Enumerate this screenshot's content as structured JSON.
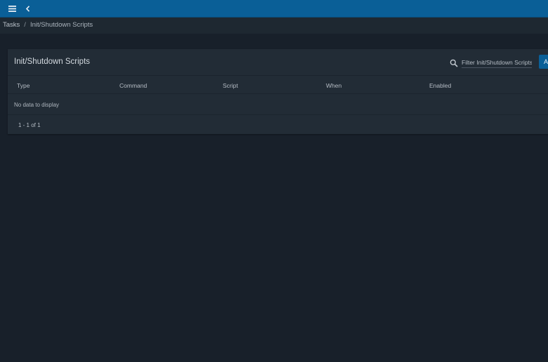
{
  "topbar": {
    "menu_icon": "hamburger-menu-icon",
    "back_icon": "chevron-left-icon",
    "color": "#0a5f97"
  },
  "breadcrumb": {
    "items": [
      "Tasks",
      "Init/Shutdown Scripts"
    ],
    "separator": "/"
  },
  "card": {
    "title": "Init/Shutdown Scripts",
    "filter_placeholder": "Filter Init/Shutdown Scripts",
    "add_button_label": "ADD",
    "search_icon": "search-icon"
  },
  "table": {
    "columns": [
      "Type",
      "Command",
      "Script",
      "When",
      "Enabled"
    ],
    "rows": [],
    "empty_message": "No data to display",
    "pagination": "1 - 1 of 1"
  },
  "colors": {
    "background": "#18202a",
    "card": "#222c36",
    "accent": "#0a5f97"
  }
}
